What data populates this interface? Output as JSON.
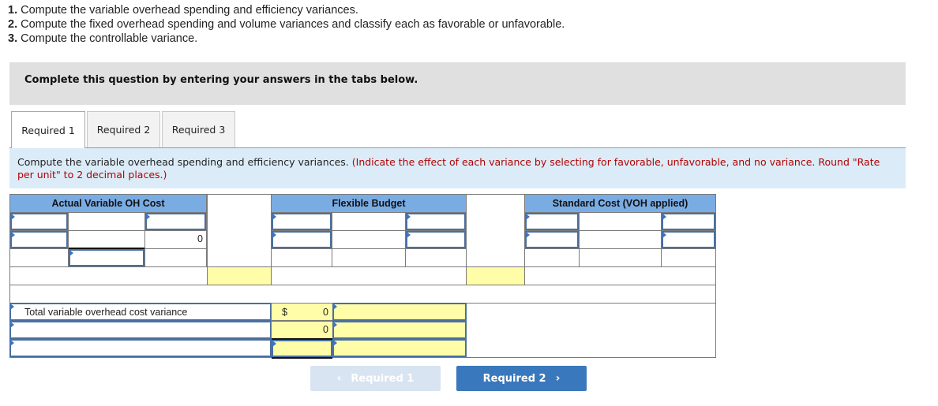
{
  "instructions": [
    {
      "num": "1.",
      "text": "Compute the variable overhead spending and efficiency variances."
    },
    {
      "num": "2.",
      "text": "Compute the fixed overhead spending and volume variances and classify each as favorable or unfavorable."
    },
    {
      "num": "3.",
      "text": "Compute the controllable variance."
    }
  ],
  "banner": "Complete this question by entering your answers in the tabs below.",
  "tabs": [
    {
      "label": "Required 1",
      "active": true
    },
    {
      "label": "Required 2",
      "active": false
    },
    {
      "label": "Required 3",
      "active": false
    }
  ],
  "prompt": {
    "text": "Compute the variable overhead spending and efficiency variances. ",
    "note": "(Indicate the effect of each variance by selecting for favorable, unfavorable, and no variance. Round \"Rate per unit\" to 2 decimal places.)"
  },
  "table": {
    "headers": {
      "actual": "Actual Variable OH Cost",
      "flexible": "Flexible Budget",
      "standard": "Standard Cost (VOH applied)"
    },
    "actual_row2_value": "0",
    "total_label": "Total variable overhead cost variance",
    "total_currency": "$",
    "total_value": "0",
    "row2_value": "0"
  },
  "nav": {
    "prev_label": "Required 1",
    "next_label": "Required 2",
    "prev_icon": "chevron-left-icon",
    "next_icon": "chevron-right-icon"
  },
  "colors": {
    "header_blue": "#7aace4",
    "input_yellow": "#fffda8",
    "prompt_bg": "#dbecf8",
    "note_red": "#b20000",
    "next_button": "#3a78bd",
    "prev_button_disabled": "#d9e4f2"
  }
}
